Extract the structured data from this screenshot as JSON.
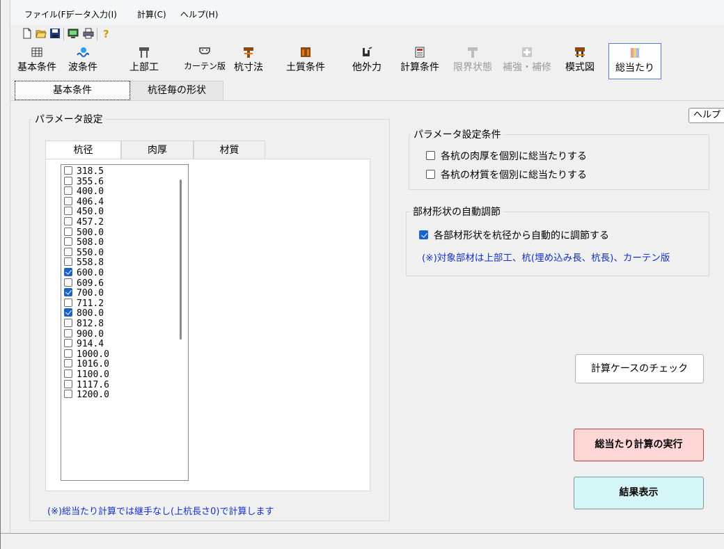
{
  "menu": [
    "ファイル(F)",
    "データ入力(I)",
    "計算(C)",
    "ヘルプ(H)"
  ],
  "toolbar_small": [
    "new-icon",
    "open-icon",
    "save-icon",
    "monitor-icon",
    "print-icon",
    "help-icon"
  ],
  "toolbar_big": [
    {
      "label": "基本条件",
      "icon": "table-icon",
      "enabled": true
    },
    {
      "label": "波条件",
      "icon": "wave-icon",
      "enabled": true
    },
    {
      "label": "上部工",
      "icon": "superstructure-icon",
      "enabled": true
    },
    {
      "label": "カーテン版",
      "icon": "curtain-icon",
      "enabled": true
    },
    {
      "label": "杭寸法",
      "icon": "pile-icon",
      "enabled": true
    },
    {
      "label": "土質条件",
      "icon": "soil-icon",
      "enabled": true
    },
    {
      "label": "他外力",
      "icon": "force-icon",
      "enabled": true
    },
    {
      "label": "計算条件",
      "icon": "calc-icon",
      "enabled": true
    },
    {
      "label": "限界状態",
      "icon": "limit-icon",
      "enabled": false
    },
    {
      "label": "補強・補修",
      "icon": "reinforce-icon",
      "enabled": false
    },
    {
      "label": "模式図",
      "icon": "diagram-icon",
      "enabled": true
    },
    {
      "label": "総当たり",
      "icon": "grid-icon",
      "enabled": true,
      "active": true
    }
  ],
  "top_tabs": [
    "基本条件",
    "杭径毎の形状"
  ],
  "help_button": "ヘルプ",
  "param_group": {
    "title": "パラメータ設定",
    "tabs": [
      "杭径",
      "肉厚",
      "材質"
    ],
    "items": [
      {
        "value": "318.5",
        "checked": false
      },
      {
        "value": "355.6",
        "checked": false
      },
      {
        "value": "400.0",
        "checked": false
      },
      {
        "value": "406.4",
        "checked": false
      },
      {
        "value": "450.0",
        "checked": false
      },
      {
        "value": "457.2",
        "checked": false
      },
      {
        "value": "500.0",
        "checked": false
      },
      {
        "value": "508.0",
        "checked": false
      },
      {
        "value": "550.0",
        "checked": false
      },
      {
        "value": "558.8",
        "checked": false
      },
      {
        "value": "600.0",
        "checked": true
      },
      {
        "value": "609.6",
        "checked": false
      },
      {
        "value": "700.0",
        "checked": true
      },
      {
        "value": "711.2",
        "checked": false
      },
      {
        "value": "800.0",
        "checked": true
      },
      {
        "value": "812.8",
        "checked": false
      },
      {
        "value": "900.0",
        "checked": false
      },
      {
        "value": "914.4",
        "checked": false
      },
      {
        "value": "1000.0",
        "checked": false
      },
      {
        "value": "1016.0",
        "checked": false
      },
      {
        "value": "1100.0",
        "checked": false
      },
      {
        "value": "1117.6",
        "checked": false
      },
      {
        "value": "1200.0",
        "checked": false
      }
    ],
    "note": "(※)総当たり計算では継手なし(上杭長さ0)で計算します"
  },
  "cond_group": {
    "title": "パラメータ設定条件",
    "options": [
      {
        "label": "各杭の肉厚を個別に総当たりする",
        "checked": false
      },
      {
        "label": "各杭の材質を個別に総当たりする",
        "checked": false
      }
    ]
  },
  "auto_group": {
    "title": "部材形状の自動調節",
    "option": {
      "label": "各部材形状を杭径から自動的に調節する",
      "checked": true
    },
    "note": "(※)対象部材は上部工、杭(埋め込み長、杭長)、カーテン版"
  },
  "buttons": {
    "check": "計算ケースのチェック",
    "execute": "総当たり計算の実行",
    "result": "結果表示"
  },
  "colors": {
    "accent": "#1c63c8",
    "note_text": "#1430c8",
    "exec_bg": "#ffd7d7",
    "result_bg": "#d5f6f6"
  }
}
